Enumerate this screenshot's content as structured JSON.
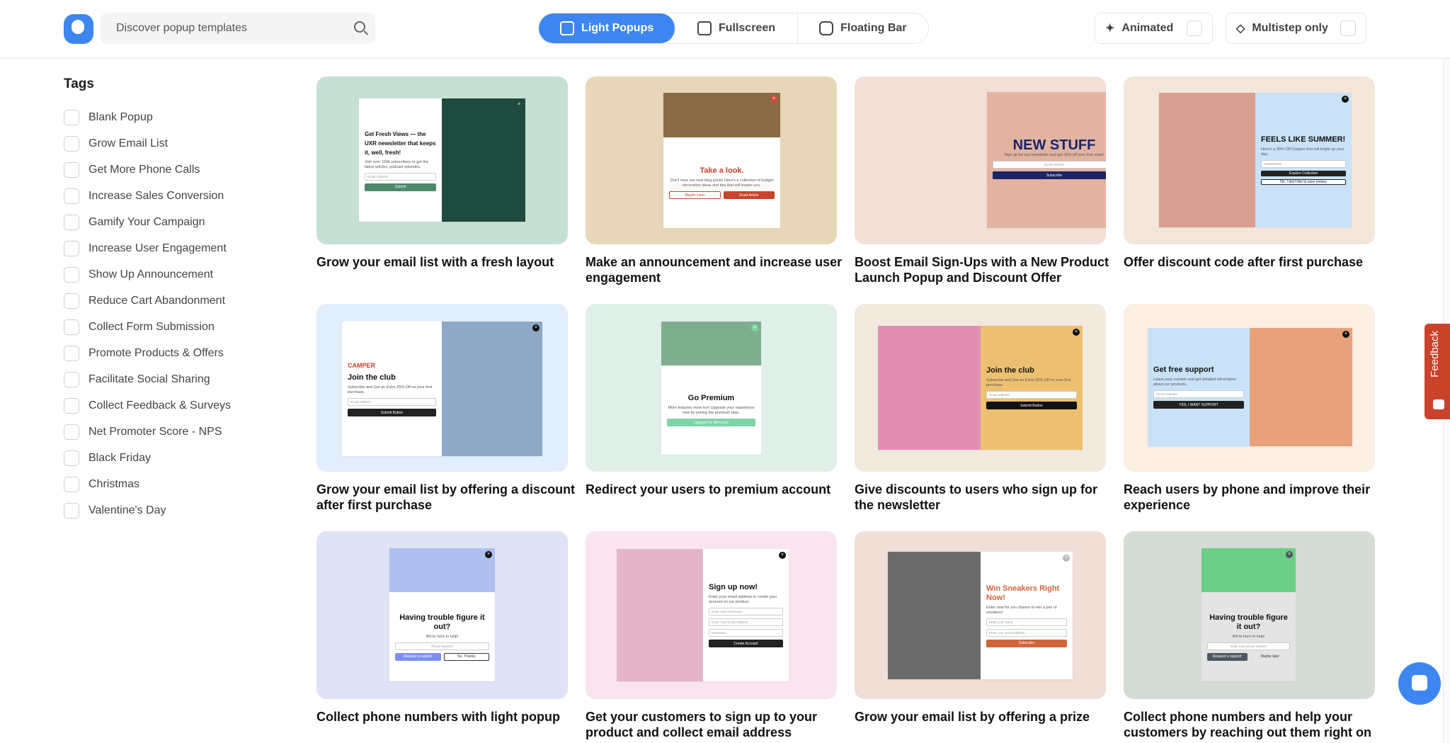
{
  "header": {
    "search_placeholder": "Discover popup templates",
    "tabs": [
      {
        "label": "Light Popups",
        "active": true,
        "icon": "light-popup-icon"
      },
      {
        "label": "Fullscreen",
        "icon": "fullscreen-icon"
      },
      {
        "label": "Floating Bar",
        "icon": "floating-bar-icon"
      }
    ],
    "animated_label": "Animated",
    "multistep_label": "Multistep only",
    "accent": "#3d86ef"
  },
  "sidebar": {
    "title": "Tags",
    "tags": [
      "Blank Popup",
      "Grow Email List",
      "Get More Phone Calls",
      "Increase Sales Conversion",
      "Gamify Your Campaign",
      "Increase User Engagement",
      "Show Up Announcement",
      "Reduce Cart Abandonment",
      "Collect Form Submission",
      "Promote Products & Offers",
      "Facilitate Social Sharing",
      "Collect Feedback & Surveys",
      "Net Promoter Score - NPS",
      "Black Friday",
      "Christmas",
      "Valentine's Day"
    ]
  },
  "cards": [
    {
      "title": "Grow your email list with a fresh layout",
      "bg": "#c6e0d4",
      "popup": {
        "bg": "#ffffff",
        "image": "#1f4a3f",
        "image_side": "right",
        "headline": "Get Fresh Views — the UXR newsletter that keeps it, well, fresh!",
        "hcolor": "#111",
        "body": "Join over 150k subscribers to get the latest articles, podcast episodes.",
        "fields": [
          "Email Address"
        ],
        "buttons": [
          {
            "label": "Submit",
            "bg": "#4f8a6b",
            "color": "#fff"
          }
        ],
        "close": "#1f4a3f"
      }
    },
    {
      "title": "Make an announcement and increase user engagement",
      "bg": "#e8d6b8",
      "popup": {
        "bg": "#ffffff",
        "image": "#8a6a45",
        "image_side": "top",
        "headline": "Take a look.",
        "hcolor": "#c9432a",
        "body": "Don't miss our new blog posts! Here's a collection of budget decoration ideas and tips that will inspire you.",
        "fields": [],
        "buttons": [
          {
            "label": "Maybe Later",
            "bg": "#fff",
            "color": "#c9432a"
          },
          {
            "label": "Read Article",
            "bg": "#c9432a",
            "color": "#fff"
          }
        ],
        "close": "#d9473a"
      }
    },
    {
      "title": "Boost Email Sign-Ups with a New Product Launch Popup and Discount Offer",
      "bg": "#f3e0d8",
      "popup": {
        "bg": "#e2b4a0",
        "image": "",
        "image_side": "none",
        "headline": "NEW STUFF",
        "hcolor": "#1a2466",
        "body": "Sign up for our newsletter and get 15% off your first order!",
        "fields": [
          "Email Address"
        ],
        "buttons": [
          {
            "label": "Subscribe",
            "bg": "#1a2466",
            "color": "#fff"
          }
        ],
        "close": "#1a2466"
      }
    },
    {
      "title": "Offer discount code after first purchase",
      "bg": "#f3e6da",
      "popup": {
        "bg": "#c9e2f7",
        "image": "#d99f92",
        "image_side": "left",
        "headline": "FEELS LIKE SUMMER!",
        "hcolor": "#111",
        "body": "Here's a 30% Off Coupon that will bright up your day.",
        "fields": [
          "SUMMER30"
        ],
        "buttons": [
          {
            "label": "Explore Collection",
            "bg": "#222",
            "color": "#fff"
          },
          {
            "label": "No, I don't like to save money",
            "bg": "#fff",
            "color": "#222"
          }
        ],
        "close": "#111"
      }
    },
    {
      "title": "Grow your email list by offering a discount after first purchase",
      "bg": "#e2eefb",
      "popup": {
        "bg": "#ffffff",
        "image": "#8fa8c8",
        "image_side": "right",
        "brand": "CAMPER",
        "headline": "Join the club",
        "hcolor": "#111",
        "body": "Subscribe and Get an Extra 25% Off on your first purchase.",
        "fields": [
          "Email Address"
        ],
        "buttons": [
          {
            "label": "Submit Button",
            "bg": "#222",
            "color": "#fff"
          }
        ],
        "close": "#111"
      }
    },
    {
      "title": "Redirect your users to premium account",
      "bg": "#e0f0e8",
      "popup": {
        "bg": "#ffffff",
        "image": "#7fae8e",
        "image_side": "top",
        "headline": "Go Premium",
        "hcolor": "#111",
        "body": "More features more fun! Upgrade your experience now by joining the premium plan.",
        "fields": [],
        "buttons": [
          {
            "label": "Upgrade for $9/month",
            "bg": "#7fd3a6",
            "color": "#fff"
          }
        ],
        "close": "#7fd3a6"
      }
    },
    {
      "title": "Give discounts to users who sign up for the newsletter",
      "bg": "#f2eade",
      "popup": {
        "bg": "#ecc070",
        "image": "#e38fb3",
        "image_side": "left",
        "headline": "Join the club",
        "hcolor": "#111",
        "body": "Subscribe and Get an Extra 25% Off on your first purchase.",
        "fields": [
          "Email Address"
        ],
        "buttons": [
          {
            "label": "Submit Button",
            "bg": "#111",
            "color": "#fff"
          }
        ],
        "close": "#111"
      }
    },
    {
      "title": "Reach users by phone and improve their experience",
      "bg": "#fcefe4",
      "popup": {
        "bg": "#c9e2f7",
        "image": "#e8a27a",
        "image_side": "right",
        "headline": "Get free support",
        "hcolor": "#111",
        "body": "Leave your number and get detailed information about our products.",
        "fields": [
          "Phone Number"
        ],
        "buttons": [
          {
            "label": "YES, I WANT SUPPORT",
            "bg": "#222",
            "color": "#fff"
          }
        ],
        "close": "#111"
      }
    },
    {
      "title": "Collect phone numbers with light popup",
      "bg": "#e0e2f5",
      "popup": {
        "bg": "#ffffff",
        "image": "#aebff0",
        "image_side": "top",
        "headline": "Having trouble figure it out?",
        "hcolor": "#111",
        "body": "We're here to help!",
        "fields": [
          "Phone Number"
        ],
        "buttons": [
          {
            "label": "Request a support",
            "bg": "#7d8ff0",
            "color": "#fff"
          },
          {
            "label": "No, Thanks",
            "bg": "#fff",
            "color": "#333"
          }
        ],
        "close": "#111"
      }
    },
    {
      "title": "Get your customers to sign up to your product and collect email address",
      "bg": "#f9e5ef",
      "popup": {
        "bg": "#ffffff",
        "image": "#e3b6c8",
        "image_side": "left",
        "headline": "Sign up now!",
        "hcolor": "#111",
        "body": "Enter your email address to create your account on our product.",
        "fields": [
          "Enter Your Username",
          "Enter Your Email Address",
          "Password"
        ],
        "buttons": [
          {
            "label": "Create Account",
            "bg": "#222",
            "color": "#fff"
          }
        ],
        "close": "#111"
      }
    },
    {
      "title": "Grow your email list by offering a prize",
      "bg": "#efdfd6",
      "popup": {
        "bg": "#ffffff",
        "image": "#6b6b6b",
        "image_side": "left",
        "headline": "Win Sneakers Right Now!",
        "hcolor": "#d0643a",
        "body": "Enter now for you chance to win a pair of sneakers!",
        "fields": [
          "Enter your name",
          "Enter your email address"
        ],
        "buttons": [
          {
            "label": "Subscribe",
            "bg": "#d0643a",
            "color": "#fff"
          }
        ],
        "close": "#bbb"
      }
    },
    {
      "title": "Collect phone numbers and help your customers by reaching out them right on",
      "bg": "#d5dcd6",
      "popup": {
        "bg": "#e4e4e4",
        "image": "#6ccf86",
        "image_side": "top",
        "headline": "Having trouble figure it out?",
        "hcolor": "#111",
        "body": "We're here to help!",
        "fields": [
          "Enter your phone number"
        ],
        "buttons": [
          {
            "label": "Request a support",
            "bg": "#4a5864",
            "color": "#fff"
          },
          {
            "label": "Maybe later",
            "bg": "#e4e4e4",
            "color": "#333"
          }
        ],
        "close": "#4a5864"
      }
    }
  ],
  "feedback_label": "Feedback"
}
